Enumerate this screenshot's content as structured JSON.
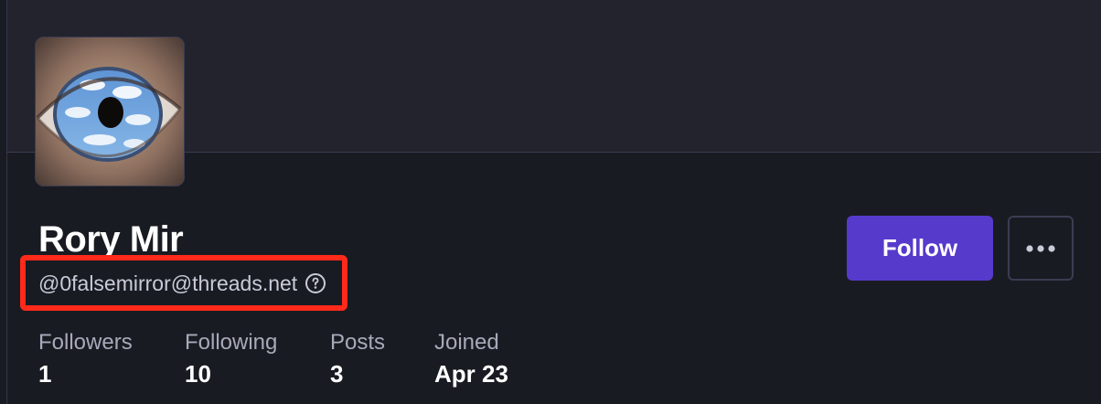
{
  "profile": {
    "display_name": "Rory Mir",
    "handle": "@0falsemirror@threads.net",
    "avatar_icon": "eye-with-clouds-painting"
  },
  "actions": {
    "follow_label": "Follow",
    "more_icon": "more-horizontal-icon"
  },
  "stats": [
    {
      "label": "Followers",
      "value": "1"
    },
    {
      "label": "Following",
      "value": "10"
    },
    {
      "label": "Posts",
      "value": "3"
    },
    {
      "label": "Joined",
      "value": "Apr 23"
    }
  ],
  "colors": {
    "background": "#191b22",
    "banner": "#22232d",
    "accent": "#563acc",
    "highlight": "#ff2a1a"
  }
}
